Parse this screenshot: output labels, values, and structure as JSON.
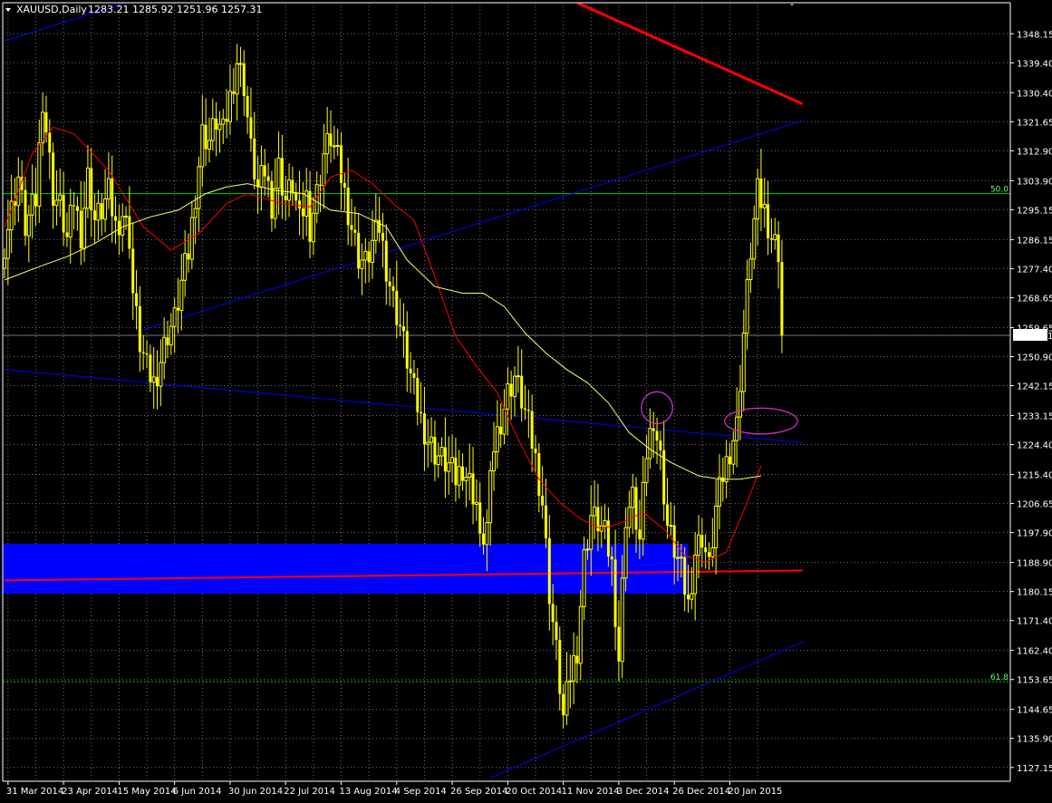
{
  "header": {
    "symbol_label": "XAUUSD,Daily",
    "ohlc_text": "1283.21 1285.92 1251.96 1257.31"
  },
  "price_marker": {
    "value": 1257.31,
    "label": "1257.31"
  },
  "colors": {
    "background": "#000000",
    "grid": "#9ea6a6",
    "candle": "#ffff00",
    "ma_fast": "#ff0000",
    "ma_slow": "#ffff66",
    "trendline": "#0000ff",
    "resistance": "#ff0000",
    "zone": "#0000ff",
    "fib": "#00cc00",
    "ellipse": "#cc33cc",
    "text": "#ffffff"
  },
  "chart_data": {
    "type": "candlestick",
    "instrument": "XAUUSD",
    "timeframe": "Daily",
    "y_axis": {
      "ylim": [
        1123.0,
        1357.5
      ],
      "ticks": [
        "1348.15",
        "1339.40",
        "1330.40",
        "1321.65",
        "1312.90",
        "1303.90",
        "1295.15",
        "1286.15",
        "1277.40",
        "1268.65",
        "1259.65",
        "1250.90",
        "1242.15",
        "1233.15",
        "1224.40",
        "1215.40",
        "1206.65",
        "1197.90",
        "1188.90",
        "1180.15",
        "1171.40",
        "1162.40",
        "1153.65",
        "1144.65",
        "1135.90",
        "1127.15"
      ]
    },
    "x_axis": {
      "labels": [
        "31 Mar 2014",
        "23 Apr 2014",
        "15 May 2014",
        "6 Jun 2014",
        "30 Jun 2014",
        "22 Jul 2014",
        "13 Aug 2014",
        "4 Sep 2014",
        "26 Sep 2014",
        "20 Oct 2014",
        "11 Nov 2014",
        "3 Dec 2014",
        "26 Dec 2014",
        "20 Jan 2015"
      ],
      "label_bar_index": [
        1,
        17,
        33,
        49,
        65,
        81,
        97,
        113,
        129,
        145,
        161,
        177,
        193,
        209
      ]
    },
    "grid": true,
    "candle_close_path": [
      [
        0,
        1285
      ],
      [
        4,
        1305
      ],
      [
        6,
        1290
      ],
      [
        9,
        1298
      ],
      [
        11,
        1329
      ],
      [
        14,
        1300
      ],
      [
        16,
        1296
      ],
      [
        18,
        1286
      ],
      [
        20,
        1298
      ],
      [
        22,
        1288
      ],
      [
        24,
        1305
      ],
      [
        26,
        1292
      ],
      [
        28,
        1295
      ],
      [
        30,
        1300
      ],
      [
        32,
        1290
      ],
      [
        34,
        1294
      ],
      [
        36,
        1287
      ],
      [
        37,
        1270
      ],
      [
        39,
        1255
      ],
      [
        41,
        1247
      ],
      [
        43,
        1243
      ],
      [
        45,
        1250
      ],
      [
        47,
        1258
      ],
      [
        49,
        1262
      ],
      [
        51,
        1273
      ],
      [
        53,
        1282
      ],
      [
        55,
        1300
      ],
      [
        57,
        1318
      ],
      [
        59,
        1316
      ],
      [
        61,
        1322
      ],
      [
        63,
        1318
      ],
      [
        65,
        1329
      ],
      [
        67,
        1340
      ],
      [
        69,
        1333
      ],
      [
        71,
        1313
      ],
      [
        73,
        1301
      ],
      [
        75,
        1307
      ],
      [
        77,
        1297
      ],
      [
        79,
        1308
      ],
      [
        81,
        1298
      ],
      [
        83,
        1303
      ],
      [
        85,
        1291
      ],
      [
        87,
        1299
      ],
      [
        88,
        1290
      ],
      [
        90,
        1300
      ],
      [
        92,
        1312
      ],
      [
        94,
        1317
      ],
      [
        96,
        1310
      ],
      [
        98,
        1300
      ],
      [
        100,
        1290
      ],
      [
        102,
        1281
      ],
      [
        104,
        1279
      ],
      [
        106,
        1285
      ],
      [
        108,
        1290
      ],
      [
        110,
        1278
      ],
      [
        112,
        1268
      ],
      [
        114,
        1260
      ],
      [
        116,
        1250
      ],
      [
        118,
        1240
      ],
      [
        120,
        1232
      ],
      [
        122,
        1226
      ],
      [
        124,
        1222
      ],
      [
        126,
        1220
      ],
      [
        128,
        1218
      ],
      [
        130,
        1214
      ],
      [
        132,
        1218
      ],
      [
        134,
        1213
      ],
      [
        136,
        1207
      ],
      [
        137,
        1194
      ],
      [
        139,
        1200
      ],
      [
        141,
        1224
      ],
      [
        143,
        1232
      ],
      [
        145,
        1240
      ],
      [
        147,
        1245
      ],
      [
        149,
        1238
      ],
      [
        151,
        1230
      ],
      [
        153,
        1220
      ],
      [
        155,
        1207
      ],
      [
        157,
        1180
      ],
      [
        159,
        1162
      ],
      [
        161,
        1142
      ],
      [
        163,
        1155
      ],
      [
        165,
        1163
      ],
      [
        167,
        1190
      ],
      [
        169,
        1203
      ],
      [
        171,
        1201
      ],
      [
        173,
        1197
      ],
      [
        175,
        1188
      ],
      [
        177,
        1160
      ],
      [
        179,
        1203
      ],
      [
        181,
        1208
      ],
      [
        183,
        1195
      ],
      [
        185,
        1222
      ],
      [
        187,
        1233
      ],
      [
        189,
        1220
      ],
      [
        191,
        1200
      ],
      [
        193,
        1193
      ],
      [
        195,
        1186
      ],
      [
        197,
        1176
      ],
      [
        199,
        1192
      ],
      [
        201,
        1197
      ],
      [
        203,
        1187
      ],
      [
        205,
        1205
      ],
      [
        207,
        1215
      ],
      [
        209,
        1223
      ],
      [
        211,
        1230
      ],
      [
        213,
        1258
      ],
      [
        215,
        1283
      ],
      [
        217,
        1300
      ],
      [
        219,
        1295
      ],
      [
        221,
        1287
      ],
      [
        223,
        1283
      ],
      [
        224,
        1257.31
      ]
    ],
    "series": [
      {
        "name": "",
        "type": "ma",
        "points": [
          [
            0,
            1290
          ],
          [
            8,
            1312
          ],
          [
            14,
            1320
          ],
          [
            20,
            1318
          ],
          [
            30,
            1307
          ],
          [
            40,
            1290
          ],
          [
            48,
            1283
          ],
          [
            56,
            1288
          ],
          [
            64,
            1297
          ],
          [
            70,
            1300
          ],
          [
            80,
            1297
          ],
          [
            88,
            1296
          ],
          [
            94,
            1305
          ],
          [
            100,
            1307
          ],
          [
            106,
            1303
          ],
          [
            112,
            1297
          ],
          [
            118,
            1292
          ],
          [
            124,
            1275
          ],
          [
            130,
            1257
          ],
          [
            136,
            1248
          ],
          [
            142,
            1240
          ],
          [
            148,
            1226
          ],
          [
            154,
            1214
          ],
          [
            160,
            1207
          ],
          [
            166,
            1202
          ],
          [
            172,
            1199
          ],
          [
            178,
            1201
          ],
          [
            184,
            1204
          ],
          [
            190,
            1199
          ],
          [
            196,
            1191
          ],
          [
            202,
            1189
          ],
          [
            208,
            1192
          ],
          [
            214,
            1207
          ],
          [
            218,
            1218
          ]
        ]
      },
      {
        "name": "",
        "type": "ma",
        "points": [
          [
            0,
            1274
          ],
          [
            10,
            1278
          ],
          [
            18,
            1281
          ],
          [
            26,
            1285
          ],
          [
            34,
            1290
          ],
          [
            42,
            1293
          ],
          [
            50,
            1295
          ],
          [
            58,
            1300
          ],
          [
            64,
            1302
          ],
          [
            70,
            1303
          ],
          [
            78,
            1301
          ],
          [
            86,
            1300
          ],
          [
            94,
            1295
          ],
          [
            102,
            1294
          ],
          [
            110,
            1290
          ],
          [
            116,
            1280
          ],
          [
            124,
            1272
          ],
          [
            132,
            1270
          ],
          [
            138,
            1270
          ],
          [
            144,
            1266
          ],
          [
            150,
            1258
          ],
          [
            156,
            1252
          ],
          [
            162,
            1247
          ],
          [
            168,
            1243
          ],
          [
            174,
            1237
          ],
          [
            180,
            1228
          ],
          [
            186,
            1223
          ],
          [
            192,
            1219
          ],
          [
            200,
            1215
          ],
          [
            206,
            1214
          ],
          [
            212,
            1214
          ],
          [
            218,
            1215
          ]
        ]
      }
    ],
    "horizontal_levels": [
      {
        "price": 1300.0,
        "label": "50.0",
        "style": "solid",
        "color": "#00cc00"
      },
      {
        "price": 1153.0,
        "label": "61.8",
        "style": "dotted",
        "color": "#00cc00"
      }
    ],
    "trendlines": [
      {
        "color": "#0000ff",
        "from": [
          0,
          1346
        ],
        "to": [
          35,
          1357.5
        ]
      },
      {
        "color": "#0000ff",
        "from": [
          0,
          1247
        ],
        "to": [
          230,
          1225
        ]
      },
      {
        "color": "#0000ff",
        "from": [
          40,
          1259
        ],
        "to": [
          230,
          1322
        ]
      },
      {
        "color": "#0000ff",
        "from": [
          140,
          1124
        ],
        "to": [
          230,
          1165
        ]
      },
      {
        "color": "#ff0000",
        "from": [
          0,
          1183.5
        ],
        "to": [
          230,
          1186.5
        ],
        "width": 2
      },
      {
        "color": "#ff0000",
        "from": [
          165,
          1357.5
        ],
        "to": [
          230,
          1327
        ],
        "width": 3
      }
    ],
    "zones": [
      {
        "from_bar": 0,
        "to_bar": 197,
        "from_price": 1179.5,
        "to_price": 1194.5,
        "color": "#0000ff"
      }
    ],
    "ellipses": [
      {
        "center": [
          188,
          1235.5
        ],
        "rx_bars": 4.5,
        "ry_price": 4.8,
        "color": "#cc33cc"
      },
      {
        "center": [
          218,
          1231.5
        ],
        "rx_bars": 10.5,
        "ry_price": 3.9,
        "color": "#cc33cc"
      }
    ]
  }
}
